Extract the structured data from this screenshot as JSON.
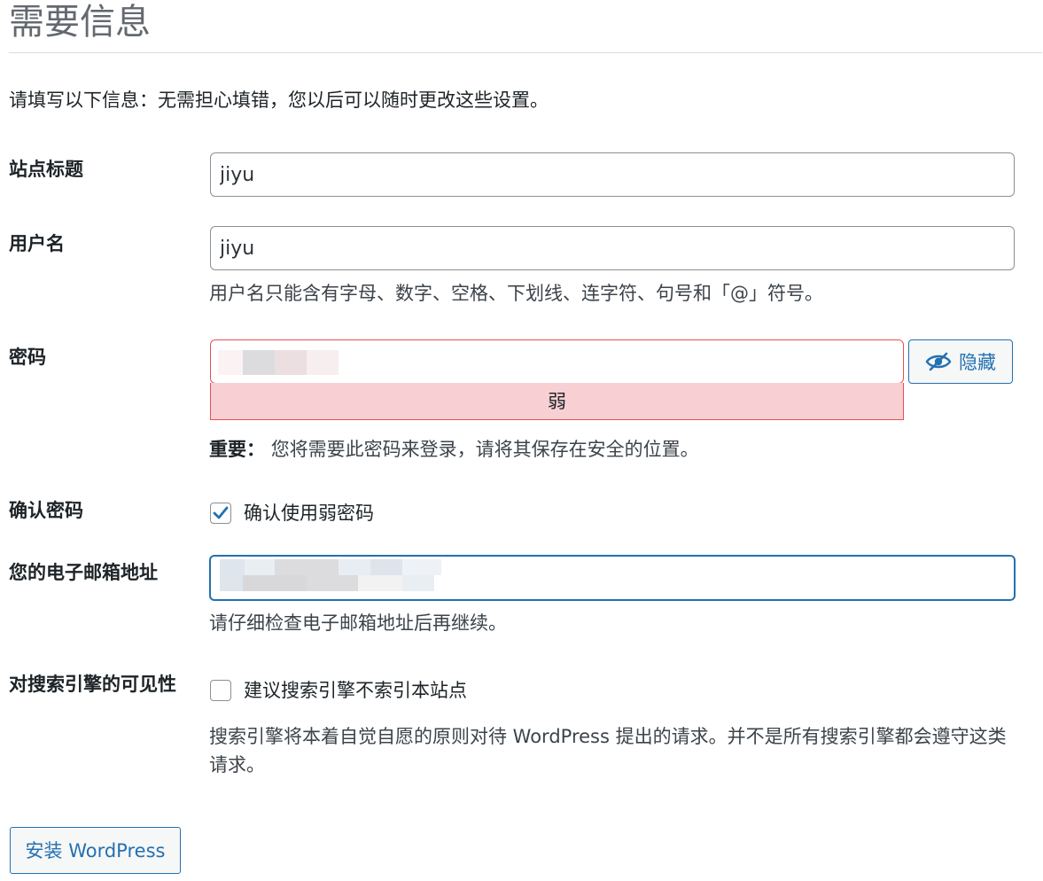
{
  "page": {
    "title": "需要信息",
    "intro": "请填写以下信息：无需担心填错，您以后可以随时更改这些设置。"
  },
  "site_title": {
    "label": "站点标题",
    "value": "jiyu"
  },
  "username": {
    "label": "用户名",
    "value": "jiyu",
    "hint": "用户名只能含有字母、数字、空格、下划线、连字符、句号和「@」符号。"
  },
  "password": {
    "label": "密码",
    "strength": "弱",
    "hide_button_label": "隐藏",
    "important_label": "重要：",
    "important_text": "您将需要此密码来登录，请将其保存在安全的位置。"
  },
  "confirm_password": {
    "label": "确认密码",
    "checkbox_label": "确认使用弱密码",
    "checked": true
  },
  "email": {
    "label": "您的电子邮箱地址",
    "hint": "请仔细检查电子邮箱地址后再继续。"
  },
  "search_visibility": {
    "label": "对搜索引擎的可见性",
    "checkbox_label": "建议搜索引擎不索引本站点",
    "checked": false,
    "hint": "搜索引擎将本着自觉自愿的原则对待 WordPress 提出的请求。并不是所有搜索引擎都会遵守这类请求。"
  },
  "install_button_label": "安装 WordPress",
  "colors": {
    "accent": "#2271b1",
    "weak_bg": "#f8d0d3",
    "weak_border": "#e65054"
  },
  "icons": {
    "hide": "eye-slash-icon",
    "check": "checkmark-icon"
  }
}
